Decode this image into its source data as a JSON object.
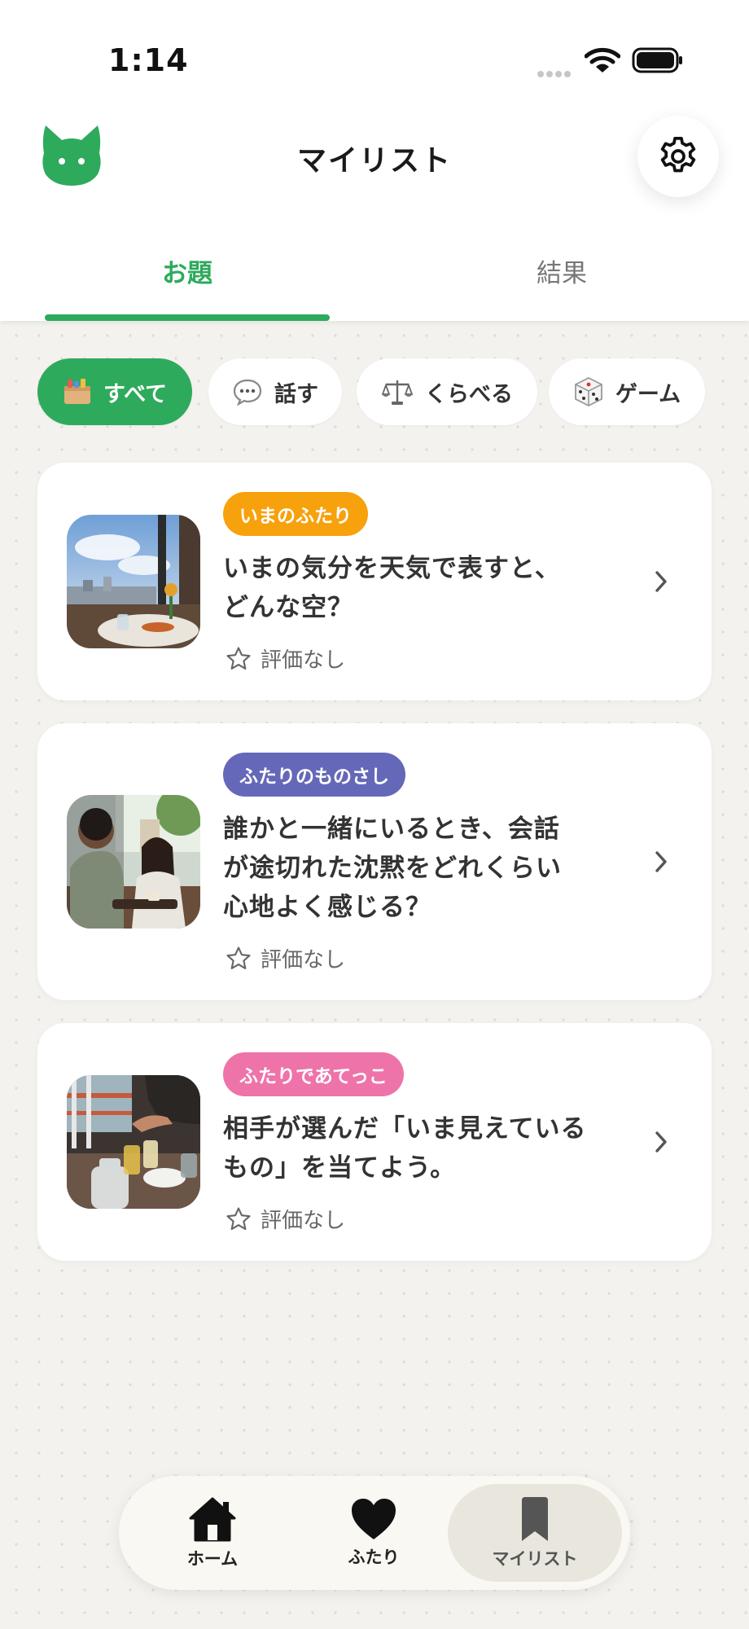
{
  "status_bar": {
    "time": "1:14"
  },
  "header": {
    "title": "マイリスト",
    "logo_icon": "cat-icon",
    "settings_icon": "gear-icon"
  },
  "tabs": [
    {
      "label": "お題",
      "active": true
    },
    {
      "label": "結果",
      "active": false
    }
  ],
  "filters": [
    {
      "label": "すべて",
      "icon": "box-icon",
      "active": true
    },
    {
      "label": "話す",
      "icon": "speech-bubble-icon",
      "active": false
    },
    {
      "label": "くらべる",
      "icon": "scale-icon",
      "active": false
    },
    {
      "label": "ゲーム",
      "icon": "dice-icon",
      "active": false
    }
  ],
  "cards": [
    {
      "tag": "いまのふたり",
      "tag_color": "#f7a10d",
      "title_lines": [
        "いまの気分を天気で表すと、",
        "どんな空？"
      ],
      "rating": "評価なし"
    },
    {
      "tag": "ふたりのものさし",
      "tag_color": "#6568b8",
      "title_lines": [
        "誰かと一緒にいるとき、会話",
        "が途切れた沈黙をどれくらい",
        "心地よく感じる？"
      ],
      "rating": "評価なし"
    },
    {
      "tag": "ふたりであてっこ",
      "tag_color": "#ee73a8",
      "title_lines": [
        "相手が選んだ「いま見えている",
        "もの」を当てよう。"
      ],
      "rating": "評価なし"
    }
  ],
  "bottom_nav": [
    {
      "label": "ホーム",
      "icon": "home-icon",
      "active": false
    },
    {
      "label": "ふたり",
      "icon": "heart-icon",
      "active": false
    },
    {
      "label": "マイリスト",
      "icon": "bookmark-icon",
      "active": true
    }
  ],
  "colors": {
    "accent": "#2eaa5c",
    "background": "#f3f2ee"
  }
}
